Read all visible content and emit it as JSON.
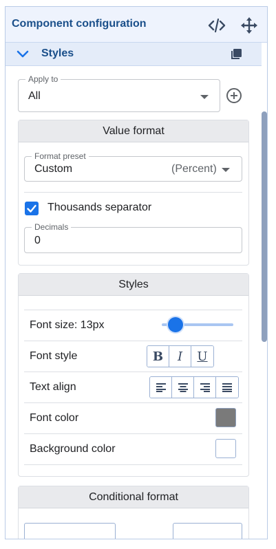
{
  "header": {
    "title": "Component configuration",
    "code_icon": "code-icon",
    "move_icon": "move-icon"
  },
  "section": {
    "label": "Styles",
    "expand_icon": "chevron-down-icon",
    "copy_icon": "copy-icon"
  },
  "apply_to": {
    "legend": "Apply to",
    "value": "All",
    "add_icon": "add-circle-icon"
  },
  "value_format": {
    "title": "Value format",
    "format_preset": {
      "legend": "Format preset",
      "value": "Custom",
      "suffix": "(Percent)"
    },
    "thousands_separator": {
      "label": "Thousands separator",
      "checked": true
    },
    "decimals": {
      "legend": "Decimals",
      "value": "0"
    }
  },
  "styles": {
    "title": "Styles",
    "font_size": {
      "label": "Font size: 13px",
      "level": 0.19
    },
    "font_style": {
      "label": "Font style",
      "buttons": [
        "B",
        "I",
        "U"
      ]
    },
    "text_align": {
      "label": "Text align",
      "options": [
        "align-left-icon",
        "align-center-icon",
        "align-right-icon",
        "align-justify-icon"
      ]
    },
    "font_color": {
      "label": "Font color",
      "color": "#7a7a7a"
    },
    "background_color": {
      "label": "Background color",
      "color": "#ffffff"
    }
  },
  "conditional_format": {
    "title": "Conditional format"
  },
  "colors": {
    "accent": "#1a73e8",
    "title": "#1a4f8a",
    "header_bg": "#eef3fd"
  }
}
